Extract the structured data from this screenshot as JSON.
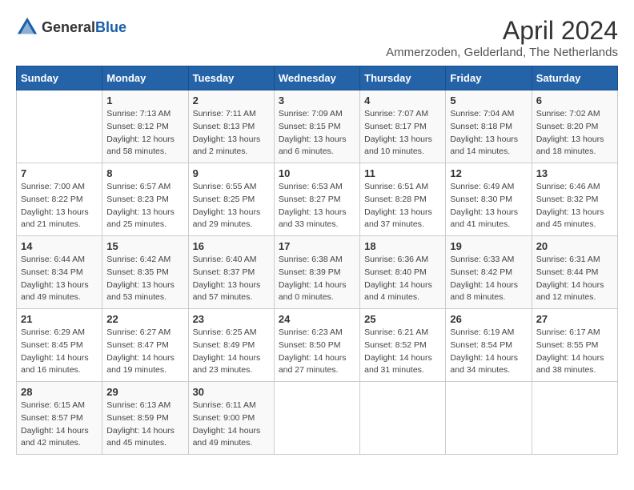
{
  "logo": {
    "text_general": "General",
    "text_blue": "Blue"
  },
  "title": "April 2024",
  "subtitle": "Ammerzoden, Gelderland, The Netherlands",
  "days_header": [
    "Sunday",
    "Monday",
    "Tuesday",
    "Wednesday",
    "Thursday",
    "Friday",
    "Saturday"
  ],
  "weeks": [
    [
      {
        "day": "",
        "sunrise": "",
        "sunset": "",
        "daylight": ""
      },
      {
        "day": "1",
        "sunrise": "Sunrise: 7:13 AM",
        "sunset": "Sunset: 8:12 PM",
        "daylight": "Daylight: 12 hours and 58 minutes."
      },
      {
        "day": "2",
        "sunrise": "Sunrise: 7:11 AM",
        "sunset": "Sunset: 8:13 PM",
        "daylight": "Daylight: 13 hours and 2 minutes."
      },
      {
        "day": "3",
        "sunrise": "Sunrise: 7:09 AM",
        "sunset": "Sunset: 8:15 PM",
        "daylight": "Daylight: 13 hours and 6 minutes."
      },
      {
        "day": "4",
        "sunrise": "Sunrise: 7:07 AM",
        "sunset": "Sunset: 8:17 PM",
        "daylight": "Daylight: 13 hours and 10 minutes."
      },
      {
        "day": "5",
        "sunrise": "Sunrise: 7:04 AM",
        "sunset": "Sunset: 8:18 PM",
        "daylight": "Daylight: 13 hours and 14 minutes."
      },
      {
        "day": "6",
        "sunrise": "Sunrise: 7:02 AM",
        "sunset": "Sunset: 8:20 PM",
        "daylight": "Daylight: 13 hours and 18 minutes."
      }
    ],
    [
      {
        "day": "7",
        "sunrise": "Sunrise: 7:00 AM",
        "sunset": "Sunset: 8:22 PM",
        "daylight": "Daylight: 13 hours and 21 minutes."
      },
      {
        "day": "8",
        "sunrise": "Sunrise: 6:57 AM",
        "sunset": "Sunset: 8:23 PM",
        "daylight": "Daylight: 13 hours and 25 minutes."
      },
      {
        "day": "9",
        "sunrise": "Sunrise: 6:55 AM",
        "sunset": "Sunset: 8:25 PM",
        "daylight": "Daylight: 13 hours and 29 minutes."
      },
      {
        "day": "10",
        "sunrise": "Sunrise: 6:53 AM",
        "sunset": "Sunset: 8:27 PM",
        "daylight": "Daylight: 13 hours and 33 minutes."
      },
      {
        "day": "11",
        "sunrise": "Sunrise: 6:51 AM",
        "sunset": "Sunset: 8:28 PM",
        "daylight": "Daylight: 13 hours and 37 minutes."
      },
      {
        "day": "12",
        "sunrise": "Sunrise: 6:49 AM",
        "sunset": "Sunset: 8:30 PM",
        "daylight": "Daylight: 13 hours and 41 minutes."
      },
      {
        "day": "13",
        "sunrise": "Sunrise: 6:46 AM",
        "sunset": "Sunset: 8:32 PM",
        "daylight": "Daylight: 13 hours and 45 minutes."
      }
    ],
    [
      {
        "day": "14",
        "sunrise": "Sunrise: 6:44 AM",
        "sunset": "Sunset: 8:34 PM",
        "daylight": "Daylight: 13 hours and 49 minutes."
      },
      {
        "day": "15",
        "sunrise": "Sunrise: 6:42 AM",
        "sunset": "Sunset: 8:35 PM",
        "daylight": "Daylight: 13 hours and 53 minutes."
      },
      {
        "day": "16",
        "sunrise": "Sunrise: 6:40 AM",
        "sunset": "Sunset: 8:37 PM",
        "daylight": "Daylight: 13 hours and 57 minutes."
      },
      {
        "day": "17",
        "sunrise": "Sunrise: 6:38 AM",
        "sunset": "Sunset: 8:39 PM",
        "daylight": "Daylight: 14 hours and 0 minutes."
      },
      {
        "day": "18",
        "sunrise": "Sunrise: 6:36 AM",
        "sunset": "Sunset: 8:40 PM",
        "daylight": "Daylight: 14 hours and 4 minutes."
      },
      {
        "day": "19",
        "sunrise": "Sunrise: 6:33 AM",
        "sunset": "Sunset: 8:42 PM",
        "daylight": "Daylight: 14 hours and 8 minutes."
      },
      {
        "day": "20",
        "sunrise": "Sunrise: 6:31 AM",
        "sunset": "Sunset: 8:44 PM",
        "daylight": "Daylight: 14 hours and 12 minutes."
      }
    ],
    [
      {
        "day": "21",
        "sunrise": "Sunrise: 6:29 AM",
        "sunset": "Sunset: 8:45 PM",
        "daylight": "Daylight: 14 hours and 16 minutes."
      },
      {
        "day": "22",
        "sunrise": "Sunrise: 6:27 AM",
        "sunset": "Sunset: 8:47 PM",
        "daylight": "Daylight: 14 hours and 19 minutes."
      },
      {
        "day": "23",
        "sunrise": "Sunrise: 6:25 AM",
        "sunset": "Sunset: 8:49 PM",
        "daylight": "Daylight: 14 hours and 23 minutes."
      },
      {
        "day": "24",
        "sunrise": "Sunrise: 6:23 AM",
        "sunset": "Sunset: 8:50 PM",
        "daylight": "Daylight: 14 hours and 27 minutes."
      },
      {
        "day": "25",
        "sunrise": "Sunrise: 6:21 AM",
        "sunset": "Sunset: 8:52 PM",
        "daylight": "Daylight: 14 hours and 31 minutes."
      },
      {
        "day": "26",
        "sunrise": "Sunrise: 6:19 AM",
        "sunset": "Sunset: 8:54 PM",
        "daylight": "Daylight: 14 hours and 34 minutes."
      },
      {
        "day": "27",
        "sunrise": "Sunrise: 6:17 AM",
        "sunset": "Sunset: 8:55 PM",
        "daylight": "Daylight: 14 hours and 38 minutes."
      }
    ],
    [
      {
        "day": "28",
        "sunrise": "Sunrise: 6:15 AM",
        "sunset": "Sunset: 8:57 PM",
        "daylight": "Daylight: 14 hours and 42 minutes."
      },
      {
        "day": "29",
        "sunrise": "Sunrise: 6:13 AM",
        "sunset": "Sunset: 8:59 PM",
        "daylight": "Daylight: 14 hours and 45 minutes."
      },
      {
        "day": "30",
        "sunrise": "Sunrise: 6:11 AM",
        "sunset": "Sunset: 9:00 PM",
        "daylight": "Daylight: 14 hours and 49 minutes."
      },
      {
        "day": "",
        "sunrise": "",
        "sunset": "",
        "daylight": ""
      },
      {
        "day": "",
        "sunrise": "",
        "sunset": "",
        "daylight": ""
      },
      {
        "day": "",
        "sunrise": "",
        "sunset": "",
        "daylight": ""
      },
      {
        "day": "",
        "sunrise": "",
        "sunset": "",
        "daylight": ""
      }
    ]
  ]
}
